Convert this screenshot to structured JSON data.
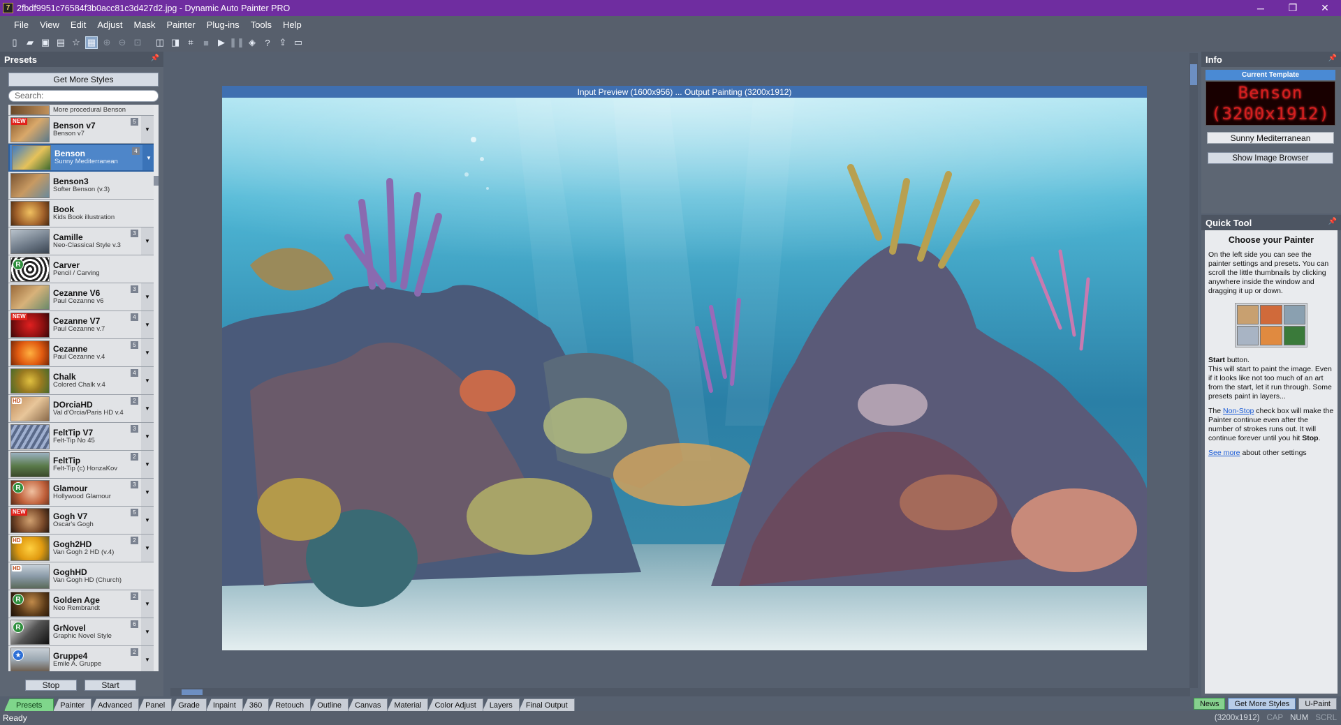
{
  "window": {
    "title": "2fbdf9951c76584f3b0acc81c3d427d2.jpg - Dynamic Auto Painter PRO",
    "icon_glyph": "7",
    "minimize": "─",
    "maximize": "❐",
    "close": "✕"
  },
  "menu": [
    "File",
    "View",
    "Edit",
    "Adjust",
    "Mask",
    "Painter",
    "Plug-ins",
    "Tools",
    "Help"
  ],
  "presets_panel": {
    "title": "Presets",
    "get_more_label": "Get More Styles",
    "search_placeholder": "Search:",
    "first_item_sub": "More procedural Benson",
    "items": [
      {
        "name": "Benson v7",
        "sub": "Benson v7",
        "num": "5",
        "badge": "NEW"
      },
      {
        "name": "Benson",
        "sub": "Sunny Mediterranean",
        "num": "4",
        "badge": "",
        "selected": true
      },
      {
        "name": "Benson3",
        "sub": "Softer Benson (v.3)",
        "num": "",
        "badge": ""
      },
      {
        "name": "Book",
        "sub": "Kids Book illustration",
        "num": "",
        "badge": ""
      },
      {
        "name": "Camille",
        "sub": "Neo-Classical Style v.3",
        "num": "3",
        "badge": ""
      },
      {
        "name": "Carver",
        "sub": "Pencil / Carving",
        "num": "",
        "badge": "R"
      },
      {
        "name": "Cezanne V6",
        "sub": "Paul Cezanne v6",
        "num": "3",
        "badge": ""
      },
      {
        "name": "Cezanne V7",
        "sub": "Paul Cezanne v.7",
        "num": "4",
        "badge": "NEW"
      },
      {
        "name": "Cezanne",
        "sub": "Paul Cezanne v.4",
        "num": "5",
        "badge": ""
      },
      {
        "name": "Chalk",
        "sub": "Colored Chalk v.4",
        "num": "4",
        "badge": ""
      },
      {
        "name": "DOrciaHD",
        "sub": "Val d'Orcia/Paris HD v.4",
        "num": "2",
        "badge": "HD"
      },
      {
        "name": "FeltTip V7",
        "sub": "Felt-Tip No 45",
        "num": "3",
        "badge": ""
      },
      {
        "name": "FeltTip",
        "sub": "Felt-Tip (c) HonzaKov",
        "num": "2",
        "badge": ""
      },
      {
        "name": "Glamour",
        "sub": "Hollywood Glamour",
        "num": "3",
        "badge": "R"
      },
      {
        "name": "Gogh V7",
        "sub": "Oscar's Gogh",
        "num": "5",
        "badge": "NEW"
      },
      {
        "name": "Gogh2HD",
        "sub": "Van Gogh 2 HD (v.4)",
        "num": "2",
        "badge": "HD"
      },
      {
        "name": "GoghHD",
        "sub": "Van Gogh HD (Church)",
        "num": "",
        "badge": "HD"
      },
      {
        "name": "Golden Age",
        "sub": "Neo Rembrandt",
        "num": "2",
        "badge": "R"
      },
      {
        "name": "GrNovel",
        "sub": "Graphic Novel Style",
        "num": "6",
        "badge": "R"
      },
      {
        "name": "Gruppe4",
        "sub": "Emile A. Gruppe",
        "num": "2",
        "badge": "star"
      }
    ],
    "stop_label": "Stop",
    "start_label": "Start"
  },
  "preview": {
    "header": "Input Preview (1600x956) ... Output Painting (3200x1912)"
  },
  "info_panel": {
    "title": "Info",
    "current_template_label": "Current Template",
    "led_line1": "Benson",
    "led_line2": "(3200x1912)",
    "template_name": "Sunny Mediterranean",
    "show_browser_label": "Show Image Browser"
  },
  "quick_tool": {
    "title": "Quick Tool",
    "heading": "Choose your Painter",
    "intro": "On the left side you can see the painter settings and presets. You can scroll the little thumbnails by clicking anywhere inside the window and dragging it up or down.",
    "start_bold": "Start",
    "start_after": " button.",
    "start_text": "This will start to paint the image. Even if it looks like not too much of an art from the start, let it run through. Some presets paint in layers...",
    "nonstop_before": "The ",
    "nonstop_link": "Non-Stop",
    "nonstop_after": " check box will make the Painter continue even after the number of strokes runs out. It will continue forever until you hit ",
    "nonstop_bold": "Stop",
    "nonstop_end": ".",
    "seemore_link": "See more",
    "seemore_after": " about other settings"
  },
  "tabs": [
    "Presets",
    "Painter",
    "Advanced",
    "Panel",
    "Grade",
    "Inpaint",
    "360",
    "Retouch",
    "Outline",
    "Canvas",
    "Material",
    "Color Adjust",
    "Layers",
    "Final Output"
  ],
  "right_tabs": {
    "news": "News",
    "get_more": "Get More Styles",
    "upaint": "U-Paint"
  },
  "status": {
    "left": "Ready",
    "size": "(3200x1912)",
    "cap": "CAP",
    "num": "NUM",
    "scrl": "SCRL"
  }
}
